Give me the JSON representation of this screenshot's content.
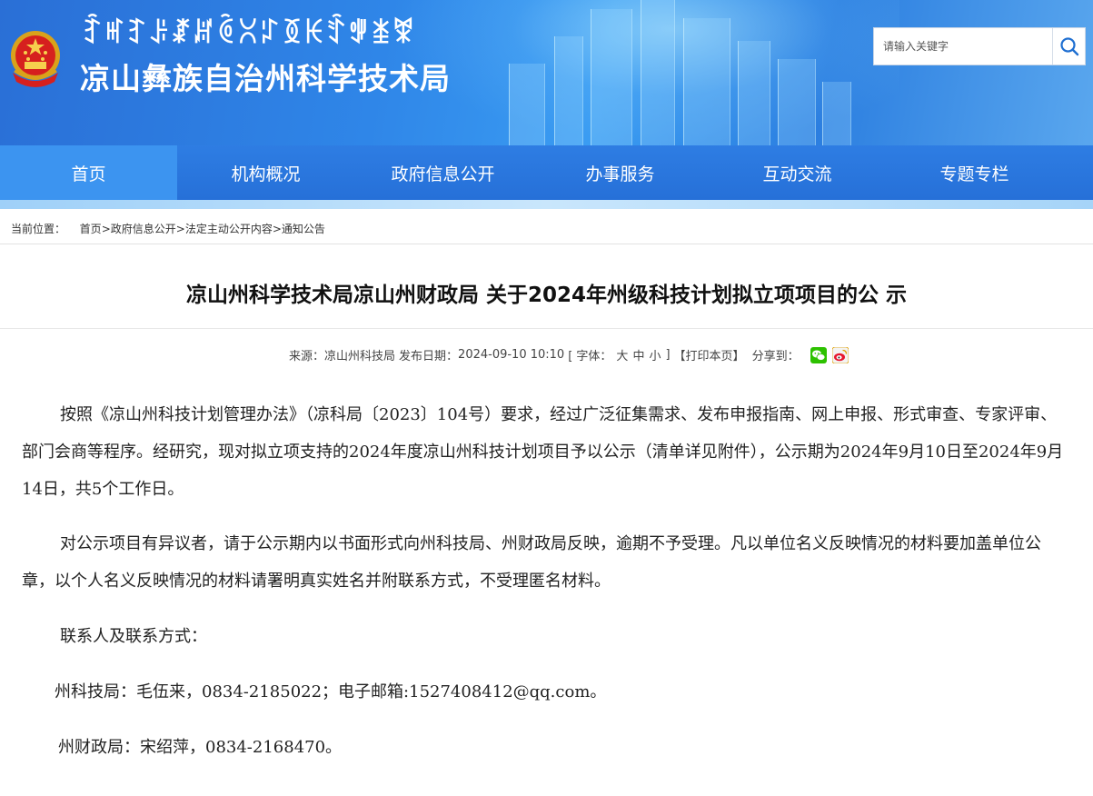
{
  "header": {
    "yi_script": "ꆇꎭꆈꌠꊨꏦꏱꇤꇱꅉꀘꄷꅚꁧꐗ",
    "site_title": "凉山彝族自治州科学技术局"
  },
  "search": {
    "placeholder": "请输入关键字"
  },
  "nav": {
    "items": [
      {
        "label": "首页"
      },
      {
        "label": "机构概况"
      },
      {
        "label": "政府信息公开"
      },
      {
        "label": "办事服务"
      },
      {
        "label": "互动交流"
      },
      {
        "label": "专题专栏"
      }
    ]
  },
  "breadcrumb": {
    "prefix": "当前位置：",
    "items": [
      "首页",
      "政府信息公开",
      "法定主动公开内容",
      "通知公告"
    ],
    "sep": ">"
  },
  "article": {
    "title": "凉山州科学技术局凉山州财政局 关于2024年州级科技计划拟立项项目的公 示",
    "meta": {
      "source_label": "来源：",
      "source": "凉山州科技局",
      "date_label": "发布日期：",
      "date": "2024-09-10 10:10",
      "font_label": "[ 字体：",
      "font_large": "大",
      "font_medium": "中",
      "font_small": "小",
      "font_close": "]",
      "print": "【打印本页】",
      "share_label": "分享到："
    },
    "paragraphs": [
      "按照《凉山州科技计划管理办法》（凉科局〔2023〕104号）要求，经过广泛征集需求、发布申报指南、网上申报、形式审查、专家评审、部门会商等程序。经研究，现对拟立项支持的2024年度凉山州科技计划项目予以公示（清单详见附件），公示期为2024年9月10日至2024年9月14日，共5个工作日。",
      "对公示项目有异议者，请于公示期内以书面形式向州科技局、州财政局反映，逾期不予受理。凡以单位名义反映情况的材料要加盖单位公章，以个人名义反映情况的材料请署明真实姓名并附联系方式，不受理匿名材料。",
      "联系人及联系方式：",
      "州科技局：毛伍来，0834-2185022；电子邮箱:1527408412@qq.com。",
      "州财政局：宋绍萍，0834-2168470。"
    ]
  },
  "colors": {
    "banner_blue": "#2f86e8",
    "nav_blue": "#2670d8",
    "nav_active": "#3c94f0",
    "wechat_green": "#2dc100",
    "weibo_red": "#e6162d"
  }
}
